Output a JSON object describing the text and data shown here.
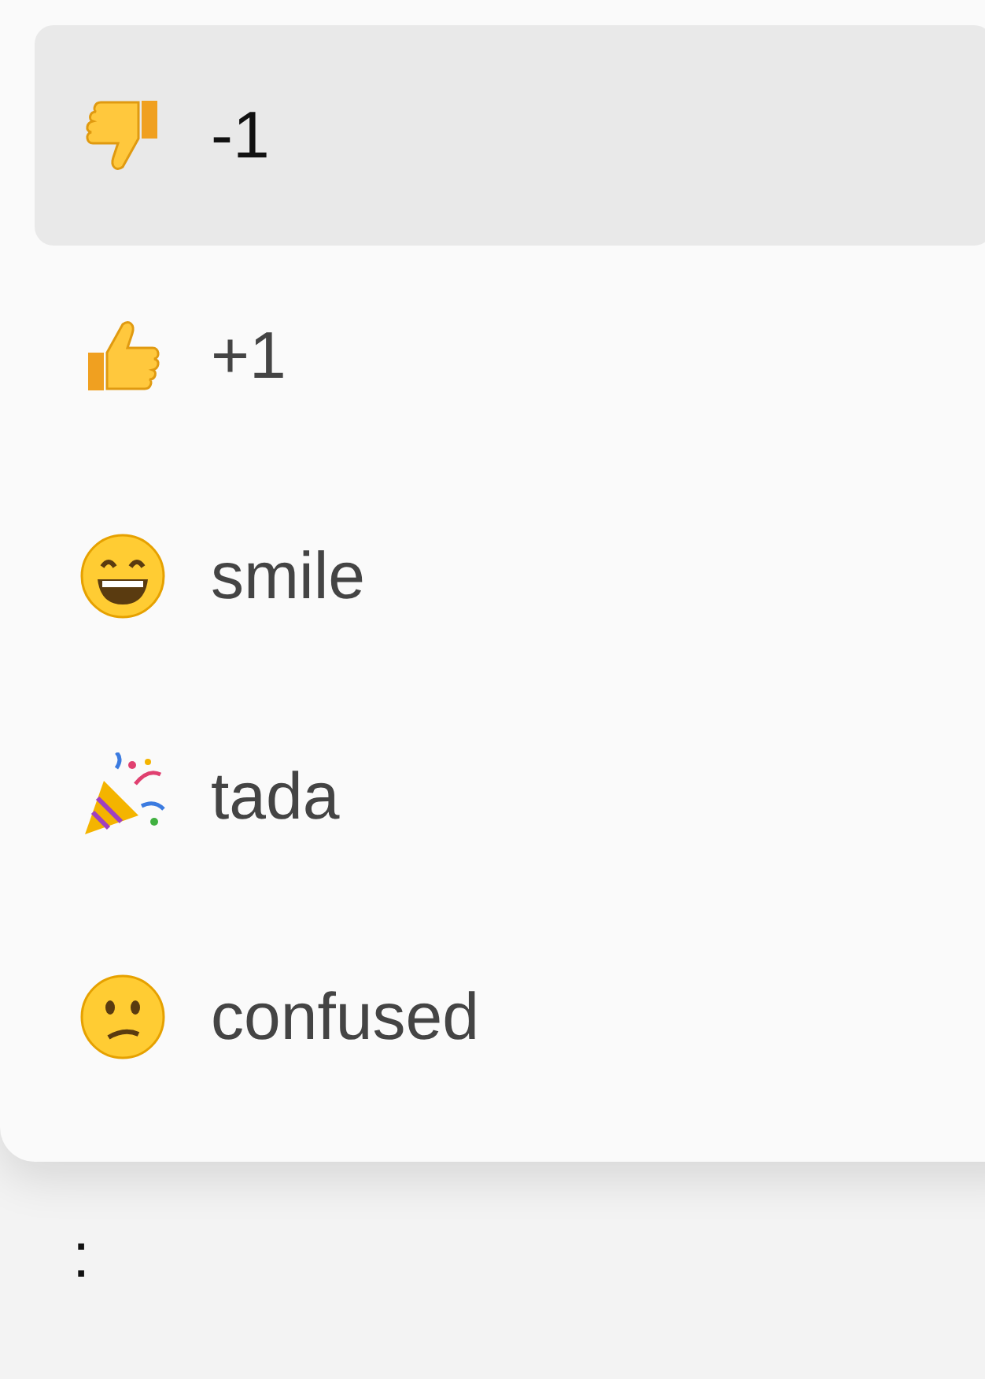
{
  "menu": {
    "items": [
      {
        "label": "-1",
        "kind": "thumbs-down",
        "selected": true
      },
      {
        "label": "+1",
        "kind": "thumbs-up",
        "selected": false
      },
      {
        "label": "smile",
        "kind": "smile",
        "selected": false
      },
      {
        "label": "tada",
        "kind": "tada",
        "selected": false
      },
      {
        "label": "confused",
        "kind": "confused",
        "selected": false
      }
    ]
  },
  "editor": {
    "text": ":"
  }
}
